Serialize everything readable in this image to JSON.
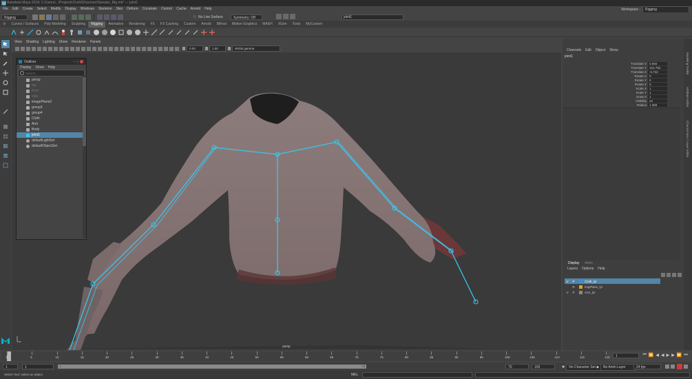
{
  "title_bar": {
    "title": "Autodesk Maya 2018: C:\\Users\\...\\Projects\\Cloth02\\scenes\\Sweater_Rig.mb* --- joint1"
  },
  "menu": [
    "File",
    "Edit",
    "Create",
    "Select",
    "Modify",
    "Display",
    "Windows",
    "Skeleton",
    "Skin",
    "Deform",
    "Constrain",
    "Control",
    "Cache",
    "Arnold",
    "Help"
  ],
  "workspace": {
    "label": "Workspace :",
    "value": "Rigging"
  },
  "status_line": {
    "mode": "Rigging",
    "no_live_surface": "No Live Surface",
    "symmetry": "Symmetry: Off",
    "name_field": "joint1"
  },
  "shelf_tabs": [
    "Curves / Surfaces",
    "Poly Modeling",
    "Sculpting",
    "Rigging",
    "Animation",
    "Rendering",
    "FX",
    "FX Caching",
    "Custom",
    "Arnold",
    "Bifrost",
    "Motion Graphics",
    "MASH",
    "XGen",
    "Tools",
    "MyCustom"
  ],
  "active_shelf": "Rigging",
  "panel_menu": [
    "View",
    "Shading",
    "Lighting",
    "Show",
    "Renderer",
    "Panels"
  ],
  "panel_toolbar": {
    "exposure": "0.00",
    "gamma": "1.00",
    "colorspace": "sRGB gamma"
  },
  "viewport_label": "persp",
  "outliner": {
    "title": "Outliner",
    "menu": [
      "Display",
      "Show",
      "Help"
    ],
    "search_placeholder": "Search...",
    "items": [
      {
        "label": "persp",
        "selected": false,
        "dim": false
      },
      {
        "label": "top",
        "selected": false,
        "dim": true
      },
      {
        "label": "front",
        "selected": false,
        "dim": true
      },
      {
        "label": "side",
        "selected": false,
        "dim": true
      },
      {
        "label": "imagePlane2",
        "selected": false,
        "dim": false
      },
      {
        "label": "group3",
        "selected": false,
        "dim": false
      },
      {
        "label": "group4",
        "selected": false,
        "dim": false
      },
      {
        "label": "Cloth",
        "selected": false,
        "dim": false
      },
      {
        "label": "Arm",
        "selected": false,
        "dim": false
      },
      {
        "label": "Body",
        "selected": false,
        "dim": false
      },
      {
        "label": "joint1",
        "selected": true,
        "dim": false
      },
      {
        "label": "defaultLightSet",
        "selected": false,
        "dim": false
      },
      {
        "label": "defaultObjectSet",
        "selected": false,
        "dim": false
      }
    ]
  },
  "channel_box": {
    "menu": [
      "Channels",
      "Edit",
      "Object",
      "Show"
    ],
    "object": "joint1",
    "channels": [
      {
        "name": "Translate X",
        "value": "0.566"
      },
      {
        "name": "Translate Y",
        "value": "101.792"
      },
      {
        "name": "Translate Z",
        "value": "-6.742"
      },
      {
        "name": "Rotate X",
        "value": "0"
      },
      {
        "name": "Rotate Y",
        "value": "0"
      },
      {
        "name": "Rotate Z",
        "value": "0"
      },
      {
        "name": "Scale X",
        "value": "1"
      },
      {
        "name": "Scale Y",
        "value": "1"
      },
      {
        "name": "Scale Z",
        "value": "1"
      },
      {
        "name": "Visibility",
        "value": "on"
      },
      {
        "name": "Radius",
        "value": "1.356"
      }
    ],
    "side_tabs": [
      "Modeling Toolkit",
      "Attribute Editor",
      "Channel Box / Layer Editor"
    ]
  },
  "layer_editor": {
    "tabs": [
      "Display",
      "Anim"
    ],
    "menu": [
      "Layers",
      "Options",
      "Help"
    ],
    "layers": [
      {
        "v": "V",
        "p": "P",
        "color": "#3d8fd1",
        "name": "Cloth_lyr",
        "selected": true
      },
      {
        "v": "",
        "p": "R",
        "color": "#e0a020",
        "name": "ImgPlane_lyr",
        "selected": false
      },
      {
        "v": "V",
        "p": "P",
        "color": "#888888",
        "name": "Arm_lyr",
        "selected": false
      }
    ]
  },
  "time_slider": {
    "ticks": [
      "1",
      "5",
      "10",
      "15",
      "20",
      "25",
      "30",
      "35",
      "40",
      "45",
      "50",
      "55",
      "60",
      "65",
      "70",
      "75",
      "80",
      "85",
      "90",
      "95",
      "100",
      "105",
      "110",
      "115",
      "120"
    ],
    "current_frame": "1"
  },
  "range_slider": {
    "start": "1",
    "inner_start": "1",
    "range_label": "70",
    "inner_end": "70",
    "end": "100",
    "character_set": "No Character Set",
    "anim_layer": "No Anim Layer",
    "fps": "24 fps"
  },
  "command_line": {
    "lang": "MEL",
    "help": "Select Tool: select an object"
  },
  "colors": {
    "accent": "#5285a6",
    "joint": "#38c8f0",
    "maya_logo": "#00b3c8"
  }
}
